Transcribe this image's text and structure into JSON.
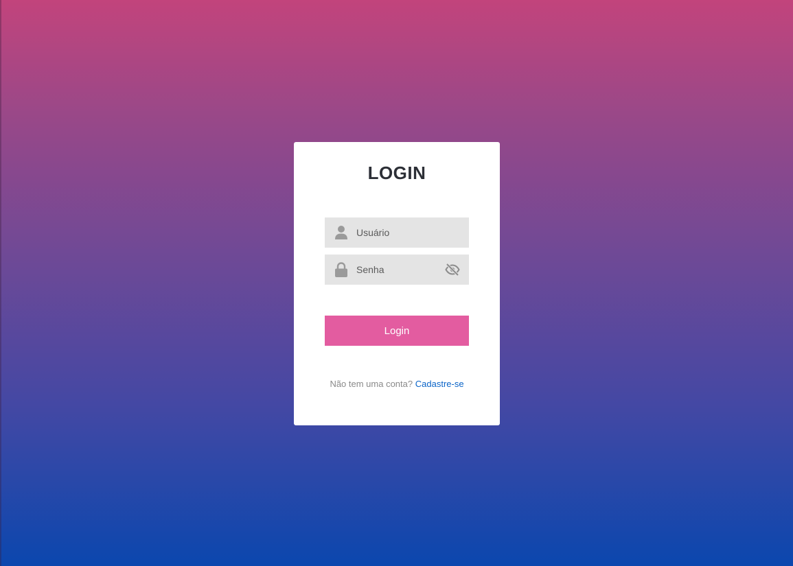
{
  "login_card": {
    "title": "LOGIN",
    "username_placeholder": "Usuário",
    "password_placeholder": "Senha",
    "submit_label": "Login",
    "signup_prompt": "Não tem uma conta?",
    "signup_link": "Cadastre-se"
  },
  "icons": {
    "username": "user-icon",
    "password": "lock-icon",
    "toggle_visibility": "eye-slash-icon"
  },
  "colors": {
    "gradient_top": "#c2447c",
    "gradient_bottom": "#0b47ae",
    "button": "#e35ca0",
    "link": "#0a64c8",
    "field_background": "#e4e4e4"
  }
}
